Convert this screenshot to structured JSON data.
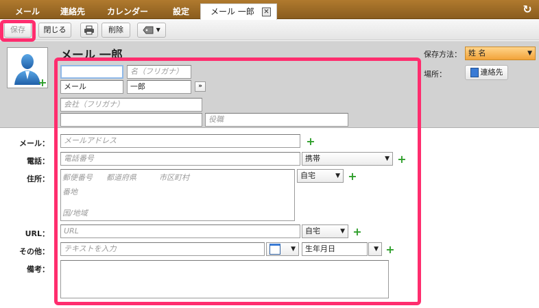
{
  "nav": {
    "tabs": [
      "メール",
      "連絡先",
      "カレンダー",
      "設定"
    ],
    "active_tab": "メール 一郎",
    "close_glyph": "✕",
    "refresh_glyph": "↻"
  },
  "toolbar": {
    "save": "保存",
    "close": "閉じる",
    "print_icon": "printer-icon",
    "delete": "削除",
    "tag_icon": "tag-icon"
  },
  "contact": {
    "display_name": "メール 一郎",
    "last_name_reading_placeholder": "",
    "first_name_reading_placeholder": "名（フリガナ）",
    "last_name": "メール",
    "first_name": "一郎",
    "expand_glyph": "»",
    "company_reading_placeholder": "会社（フリガナ）",
    "company_placeholder": "",
    "title_placeholder": "役職"
  },
  "side": {
    "save_as_label": "保存方法：",
    "save_as_value": "姓 名",
    "location_label": "場所：",
    "location_value": "連絡先"
  },
  "fields": {
    "email_label": "メール：",
    "email_placeholder": "メールアドレス",
    "phone_label": "電話：",
    "phone_placeholder": "電話番号",
    "phone_type": "携帯",
    "address_label": "住所：",
    "postal_placeholder": "郵便番号",
    "prefecture_placeholder": "都道府県",
    "city_placeholder": "市区町村",
    "street_placeholder": "番地",
    "country_placeholder": "国/地域",
    "address_type": "自宅",
    "url_label": "URL：",
    "url_placeholder": "URL",
    "url_type": "自宅",
    "other_label": "その他：",
    "other_placeholder": "テキストを入力",
    "other_type": "生年月日",
    "notes_label": "備考："
  },
  "colors": {
    "highlight": "#ff2d6e",
    "topbar": "#9a6a25",
    "plus": "#2e9e2a"
  }
}
